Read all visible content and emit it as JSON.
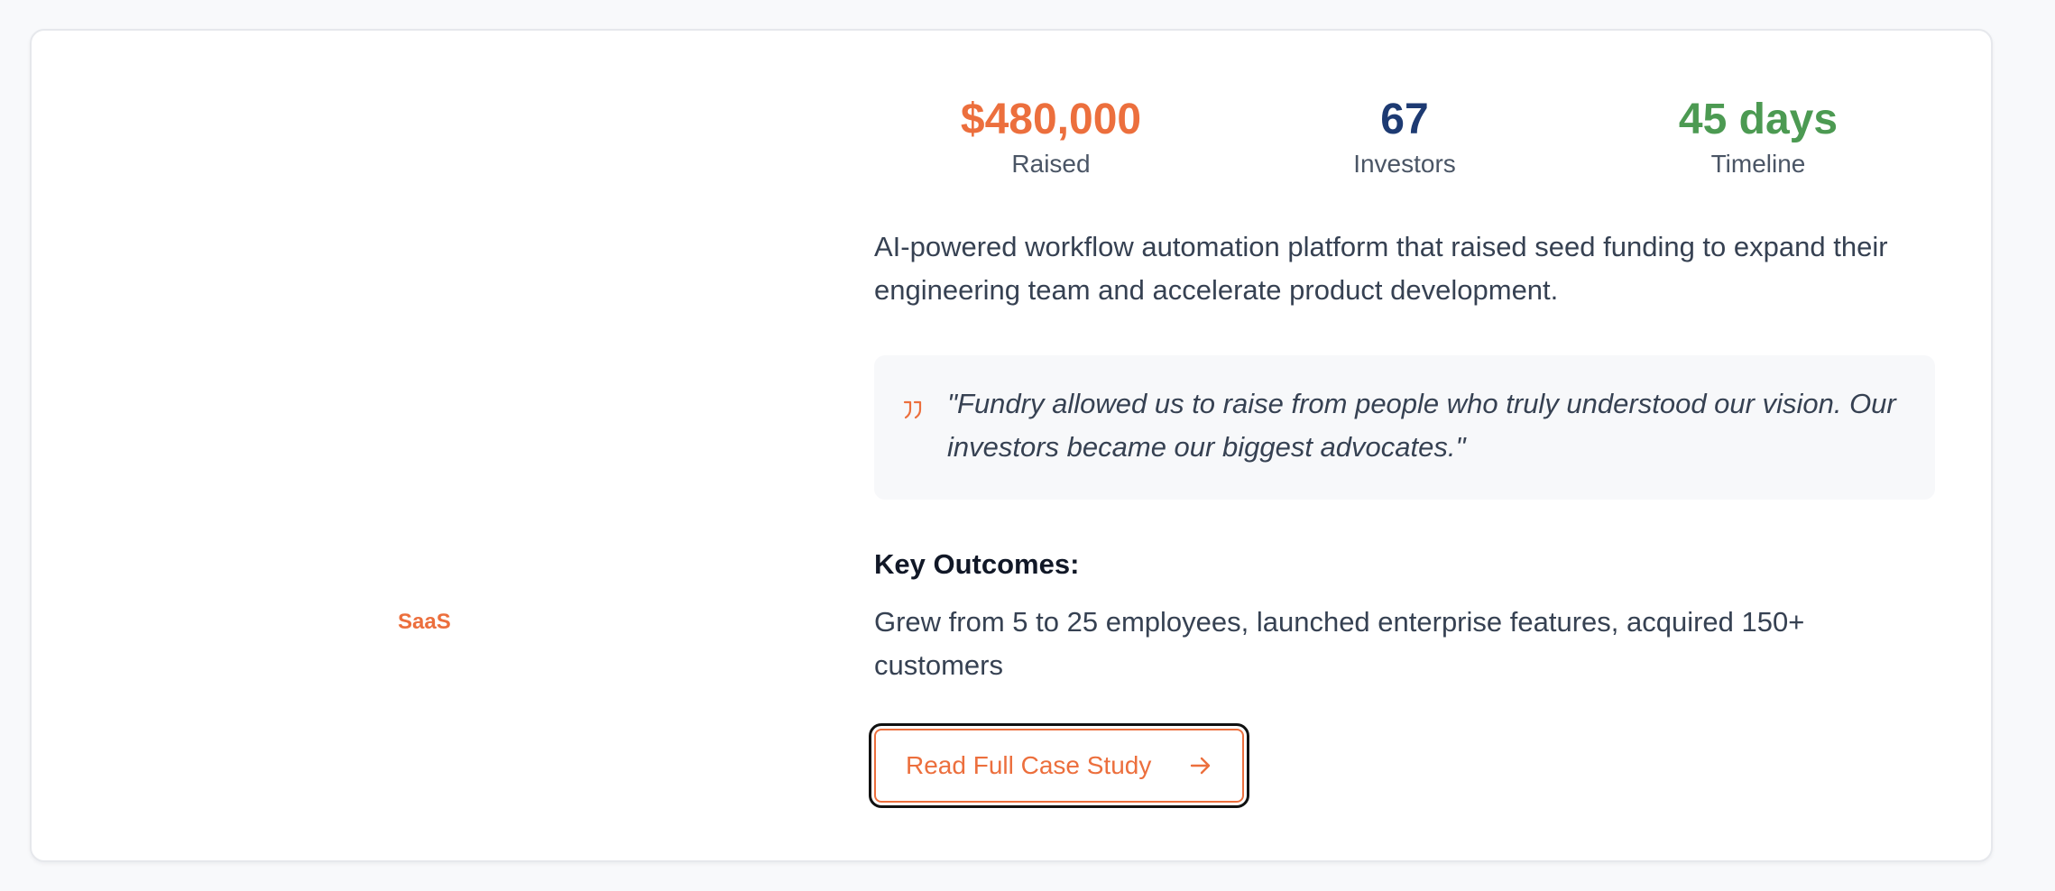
{
  "case_study": {
    "category": "SaaS",
    "stats": [
      {
        "value": "$480,000",
        "label": "Raised",
        "color": "#ec6f3d"
      },
      {
        "value": "67",
        "label": "Investors",
        "color": "#1d3a72"
      },
      {
        "value": "45 days",
        "label": "Timeline",
        "color": "#4c9a52"
      }
    ],
    "description": "AI-powered workflow automation platform that raised seed funding to expand their engineering team and accelerate product development.",
    "quote": "\"Fundry allowed us to raise from people who truly understood our vision. Our investors became our biggest advocates.\"",
    "quote_icon": "quote-icon",
    "outcomes_title": "Key Outcomes:",
    "outcomes_text": "Grew from 5 to 25 employees, launched enterprise features, acquired 150+ customers",
    "cta_label": "Read Full Case Study",
    "cta_icon": "arrow-right-icon",
    "accent_color": "#ec6f3d"
  }
}
